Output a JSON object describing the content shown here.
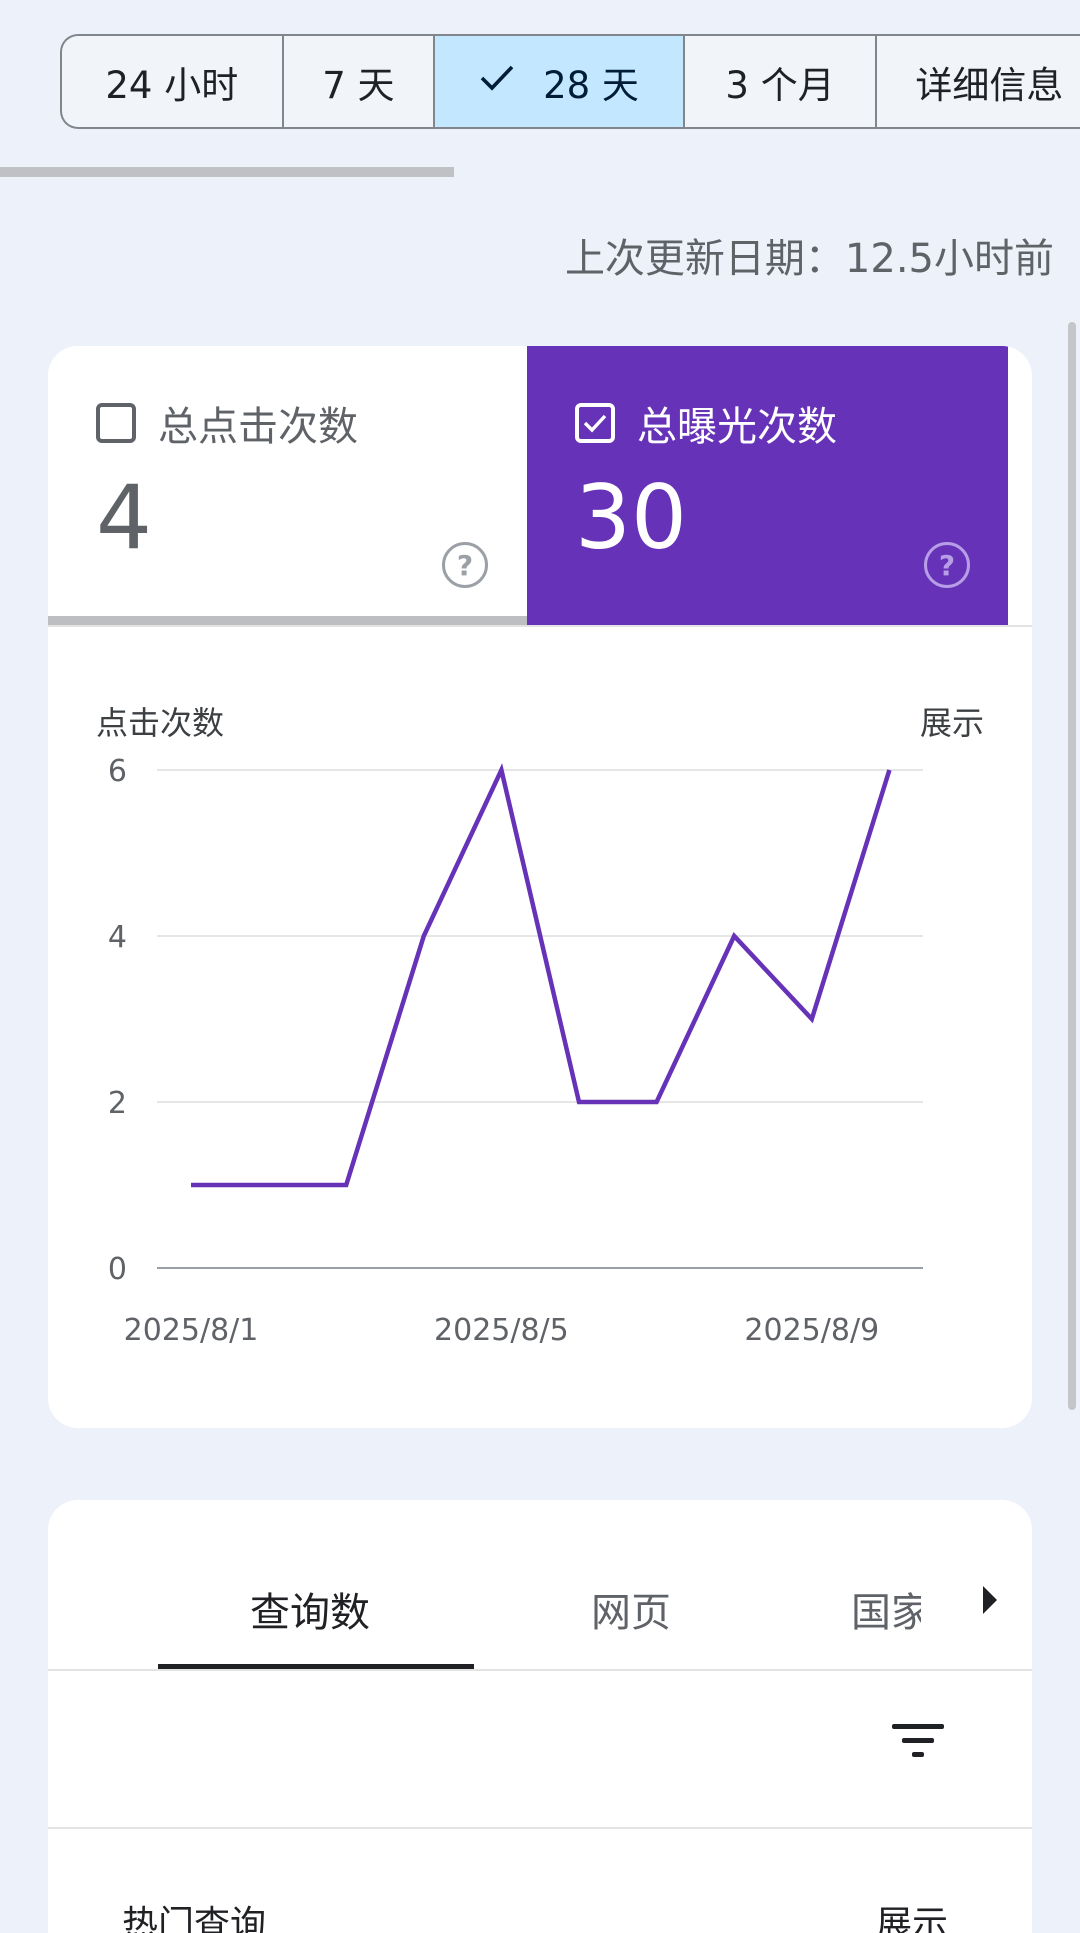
{
  "date_range": {
    "chips": [
      {
        "label": "24 小时",
        "selected": false
      },
      {
        "label": "7 天",
        "selected": false
      },
      {
        "label": "28 天",
        "selected": true
      },
      {
        "label": "3 个月",
        "selected": false
      },
      {
        "label": "详细信息",
        "selected": false
      }
    ],
    "selected_check_icon": "check-icon"
  },
  "last_update": "上次更新日期：12.5小时前",
  "metrics": {
    "clicks": {
      "label": "总点击次数",
      "value": "4",
      "checked": false,
      "help_glyph": "?"
    },
    "impressions": {
      "label": "总曝光次数",
      "value": "30",
      "checked": true,
      "help_glyph": "?",
      "color": "#6633b8"
    }
  },
  "chart_axis_titles": {
    "left": "点击次数",
    "right": "展示"
  },
  "chart_data": {
    "type": "line",
    "x": [
      "2025/8/1",
      "2025/8/2",
      "2025/8/3",
      "2025/8/4",
      "2025/8/5",
      "2025/8/6",
      "2025/8/7",
      "2025/8/8",
      "2025/8/9",
      "2025/8/10"
    ],
    "x_tick_labels": [
      "2025/8/1",
      "2025/8/5",
      "2025/8/9"
    ],
    "series": [
      {
        "values": [
          1,
          1,
          1,
          4,
          6,
          2,
          2,
          4,
          3,
          6
        ],
        "color": "#6633b8"
      }
    ],
    "y_ticks": [
      0,
      2,
      4,
      6
    ],
    "ylim": [
      0,
      6
    ],
    "grid": true
  },
  "tabs": {
    "items": [
      "查询数",
      "网页",
      "国家"
    ],
    "active": 0
  },
  "table": {
    "filter_icon": "filter-icon",
    "header_left": "热门查询",
    "header_right": "展示"
  }
}
